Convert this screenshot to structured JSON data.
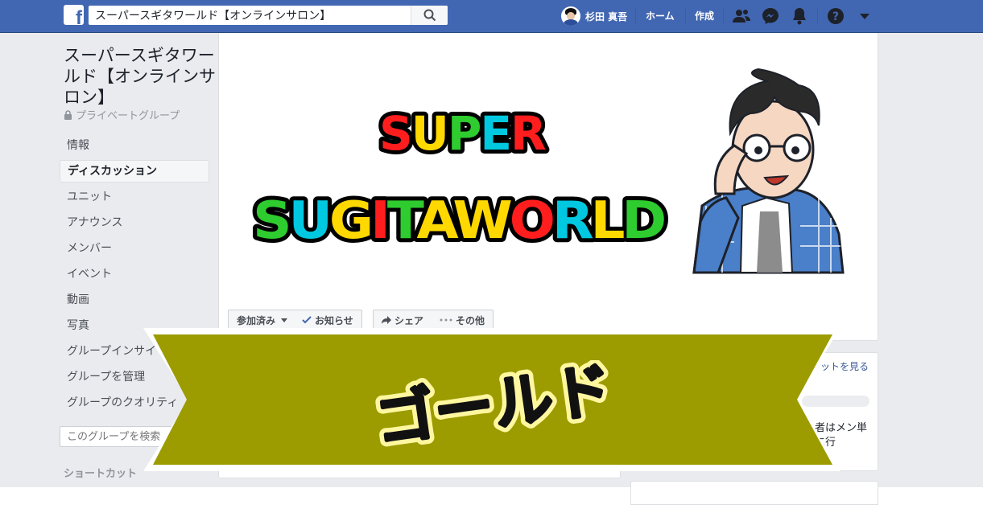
{
  "topbar": {
    "logo_letter": "f",
    "search_value": "スーパースギタワールド【オンラインサロン】",
    "user_name": "杉田 真吾",
    "home_label": "ホーム",
    "create_label": "作成"
  },
  "group": {
    "title": "スーパースギタワールド【オンラインサロン】",
    "privacy": "プライベートグループ"
  },
  "sidebar": {
    "items": [
      {
        "label": "情報"
      },
      {
        "label": "ディスカッション",
        "active": true
      },
      {
        "label": "ユニット"
      },
      {
        "label": "アナウンス"
      },
      {
        "label": "メンバー"
      },
      {
        "label": "イベント"
      },
      {
        "label": "動画"
      },
      {
        "label": "写真"
      },
      {
        "label": "グループインサイ"
      },
      {
        "label": "グループを管理"
      },
      {
        "label": "グループのクオリティ"
      }
    ],
    "search_placeholder": "このグループを検索",
    "shortcut_label": "ショートカット"
  },
  "cover": {
    "line1": "SUPER",
    "line2_letters": [
      "S",
      "U",
      "G",
      "I",
      "T",
      "A",
      "W",
      "O",
      "R",
      "L",
      "D"
    ],
    "line2_colors": [
      "#2ecc2e",
      "#00c8e0",
      "#ffd800",
      "#ff1d1d",
      "#2ecc2e",
      "#ffd800",
      "#ffd800",
      "#ff1d1d",
      "#00c8e0",
      "#ffd800",
      "#2ecc2e"
    ]
  },
  "actions": {
    "joined": "参加済み",
    "notifications": "お知らせ",
    "share": "シェア",
    "more": "その他"
  },
  "right_card": {
    "link_label": "ットを見る",
    "snippet": "者はメン単に行"
  },
  "banner": {
    "text": "ゴールド",
    "color": "#9c9c00"
  }
}
